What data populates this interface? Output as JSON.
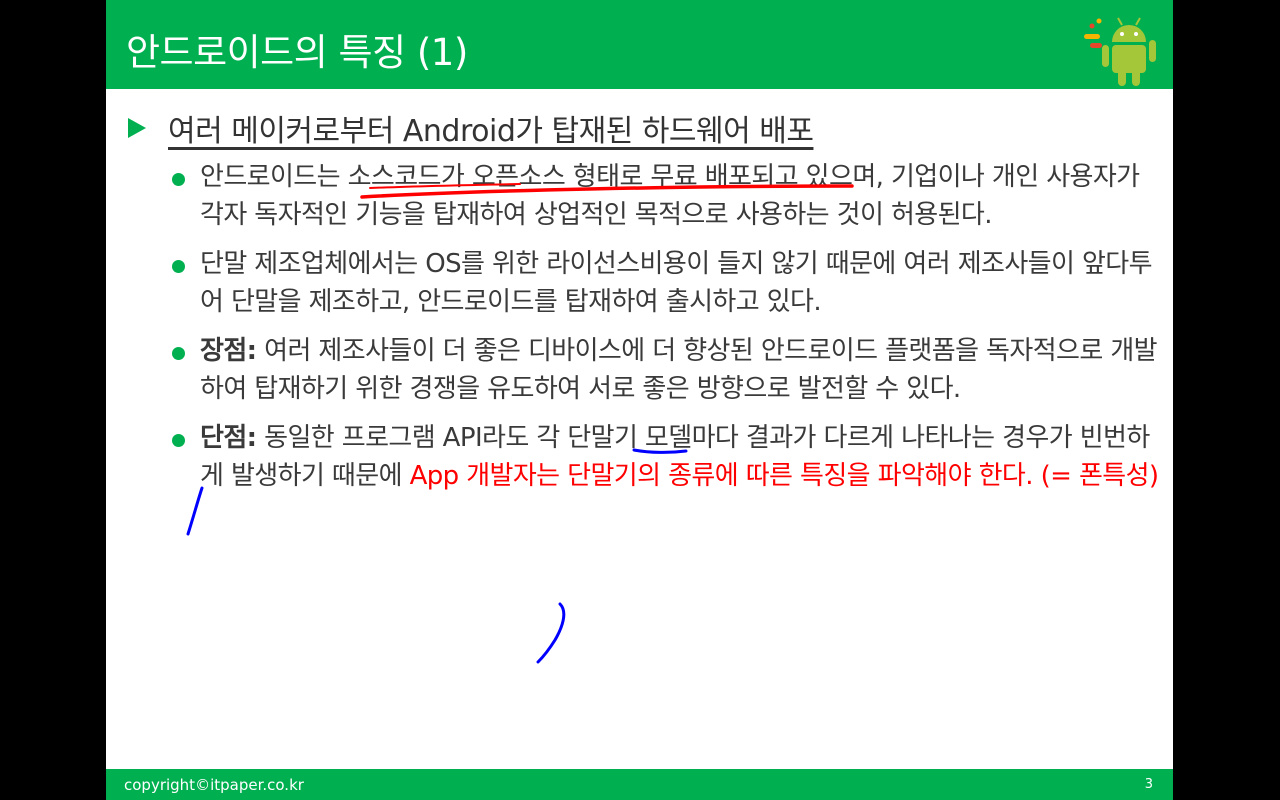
{
  "slide": {
    "title": "안드로이드의 특징 (1)",
    "heading": "여러 메이커로부터 Android가 탑재된 하드웨어 배포",
    "bullets": [
      {
        "pre": "안드로이드는 ",
        "underlined": "소스코드가 오픈소스 형태로 무료 배포",
        "post": "되고 있으며, 기업이나 개인 사용자가 각자 독자적인 기능을 탑재하여 상업적인 목적으로 사용하는 것이 허용된다."
      },
      {
        "text": "단말 제조업체에서는 OS를 위한 라이선스비용이 들지 않기 때문에 여러 제조사들이 앞다투어 단말을 제조하고, 안드로이드를 탑재하여 출시하고 있다."
      },
      {
        "bold": "장점:",
        "text": " 여러 제조사들이 더 좋은 디바이스에 더 향상된 안드로이드 플랫폼을 독자적으로 개발하여 탑재하기 위한 경쟁을 유도하여 서로 좋은 방향으로 발전할 수 있다."
      },
      {
        "bold": "단점:",
        "text": " 동일한 프로그램 API라도 각 단말기 모델마다 결과가 다르게 나타나는 경우가 빈번하게 발생하기 때문에 ",
        "red_text": "App 개발자는 단말기의 종류에 따른 특징을 파악해야 한다. (= 폰특성)"
      }
    ]
  },
  "footer": {
    "copyright": "copyright©itpaper.co.kr",
    "page_number": "3"
  },
  "colors": {
    "accent_green": "#00b050",
    "annotation_red": "#ff0000",
    "annotation_blue": "#0000ff",
    "body_text": "#3a3a3a"
  },
  "icons": [
    "android-robot-icon",
    "arrow-bullet-icon"
  ]
}
